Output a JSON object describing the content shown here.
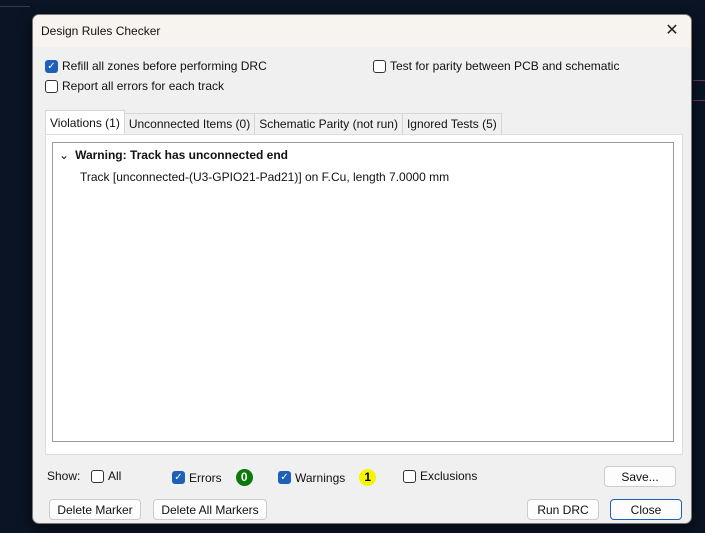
{
  "dialog": {
    "title": "Design Rules Checker"
  },
  "options": {
    "refill": "Refill all zones before performing DRC",
    "refill_checked": true,
    "report_all": "Report all errors for each track",
    "report_all_checked": false,
    "parity": "Test for parity between PCB and schematic",
    "parity_checked": false
  },
  "tabs": [
    "Violations (1)",
    "Unconnected Items (0)",
    "Schematic Parity (not run)",
    "Ignored Tests (5)"
  ],
  "violations": [
    {
      "title": "Warning: Track has unconnected end",
      "detail": "Track [unconnected-(U3-GPIO21-Pad21)] on F.Cu, length 7.0000 mm"
    }
  ],
  "show": {
    "label": "Show:",
    "all": "All",
    "errors": "Errors",
    "errors_count": "0",
    "warnings": "Warnings",
    "warnings_count": "1",
    "exclusions": "Exclusions"
  },
  "colors": {
    "errors_badge": "#0a7a0a",
    "warnings_badge": "#f5f500"
  },
  "buttons": {
    "save": "Save...",
    "delete_marker": "Delete Marker",
    "delete_all": "Delete All Markers",
    "run_drc": "Run DRC",
    "close": "Close"
  }
}
